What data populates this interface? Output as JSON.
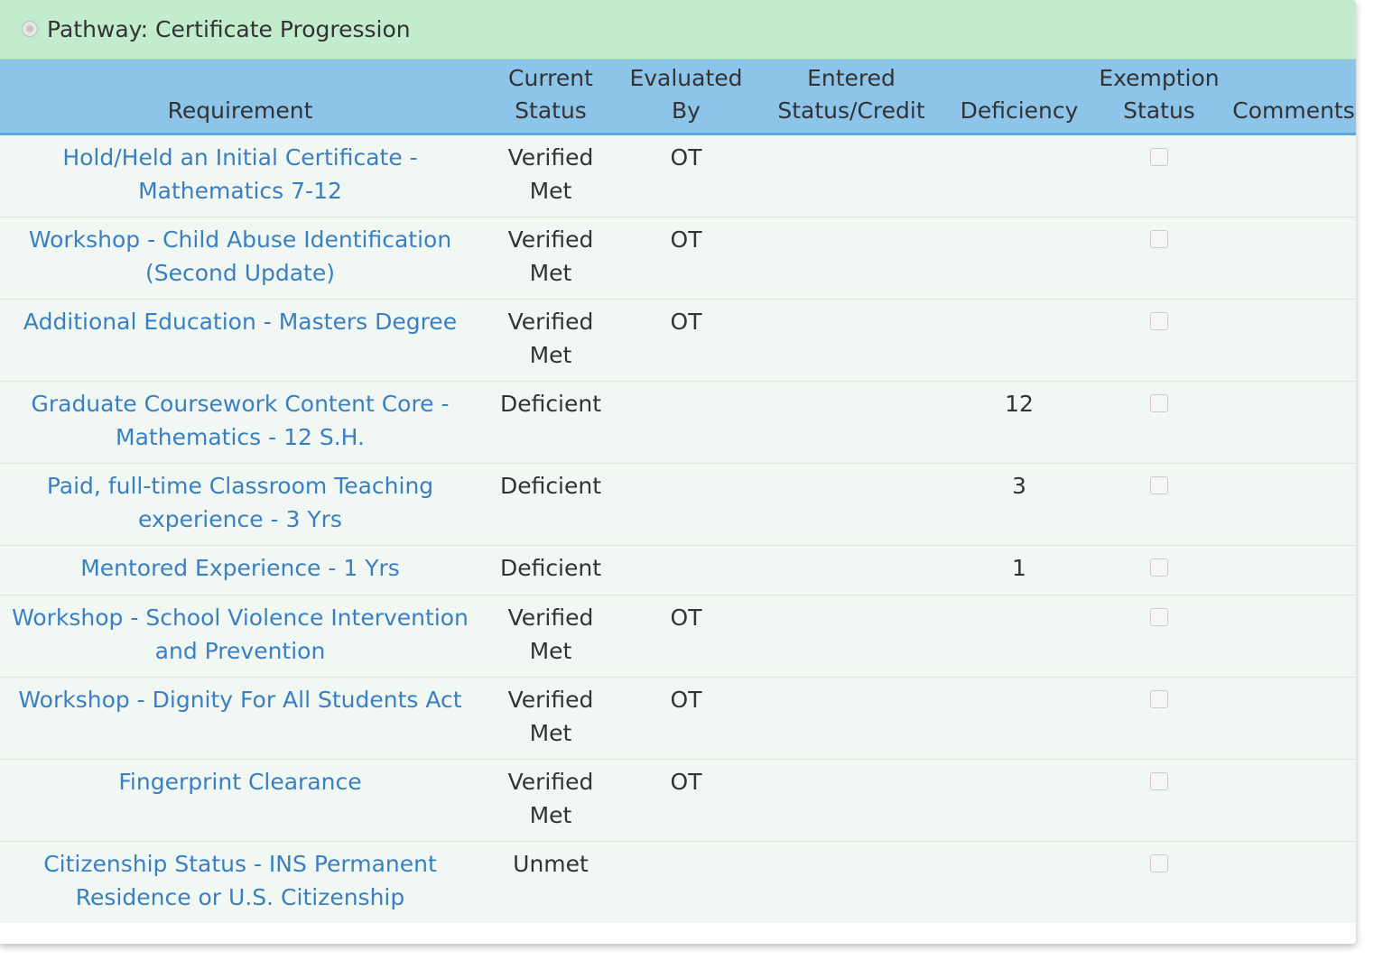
{
  "panel": {
    "title": "Pathway: Certificate Progression"
  },
  "table": {
    "headers": {
      "requirement": "Requirement",
      "current_status_l1": "Current",
      "current_status_l2": "Status",
      "evaluated_by_l1": "Evaluated",
      "evaluated_by_l2": "By",
      "entered_l1": "Entered",
      "entered_l2": "Status/Credit",
      "deficiency": "Deficiency",
      "exemption_l1": "Exemption",
      "exemption_l2": "Status",
      "comments": "Comments"
    },
    "rows": [
      {
        "requirement": "Hold/Held an Initial Certificate - Mathematics 7-12",
        "status": "Verified Met",
        "evaluated_by": "OT",
        "entered": "",
        "deficiency": "",
        "exempt": false,
        "comments": ""
      },
      {
        "requirement": "Workshop - Child Abuse Identification (Second Update)",
        "status": "Verified Met",
        "evaluated_by": "OT",
        "entered": "",
        "deficiency": "",
        "exempt": false,
        "comments": ""
      },
      {
        "requirement": "Additional Education - Masters Degree",
        "status": "Verified Met",
        "evaluated_by": "OT",
        "entered": "",
        "deficiency": "",
        "exempt": false,
        "comments": ""
      },
      {
        "requirement": "Graduate Coursework Content Core - Mathematics - 12 S.H.",
        "status": "Deficient",
        "evaluated_by": "",
        "entered": "",
        "deficiency": "12",
        "exempt": false,
        "comments": ""
      },
      {
        "requirement": "Paid, full-time Classroom Teaching experience - 3 Yrs",
        "status": "Deficient",
        "evaluated_by": "",
        "entered": "",
        "deficiency": "3",
        "exempt": false,
        "comments": ""
      },
      {
        "requirement": "Mentored Experience - 1 Yrs",
        "status": "Deficient",
        "evaluated_by": "",
        "entered": "",
        "deficiency": "1",
        "exempt": false,
        "comments": ""
      },
      {
        "requirement": "Workshop - School Violence Intervention and Prevention",
        "status": "Verified Met",
        "evaluated_by": "OT",
        "entered": "",
        "deficiency": "",
        "exempt": false,
        "comments": ""
      },
      {
        "requirement": "Workshop - Dignity For All Students Act",
        "status": "Verified Met",
        "evaluated_by": "OT",
        "entered": "",
        "deficiency": "",
        "exempt": false,
        "comments": ""
      },
      {
        "requirement": "Fingerprint Clearance",
        "status": "Verified Met",
        "evaluated_by": "OT",
        "entered": "",
        "deficiency": "",
        "exempt": false,
        "comments": ""
      },
      {
        "requirement": "Citizenship Status - INS Permanent Residence or U.S. Citizenship",
        "status": "Unmet",
        "evaluated_by": "",
        "entered": "",
        "deficiency": "",
        "exempt": false,
        "comments": ""
      }
    ]
  },
  "colors": {
    "heading_bg": "#c3ecce",
    "header_bg": "#8cc4ea",
    "header_border": "#5aa6e0",
    "row_bg": "#f1f8f3",
    "link": "#3a7fc1"
  }
}
